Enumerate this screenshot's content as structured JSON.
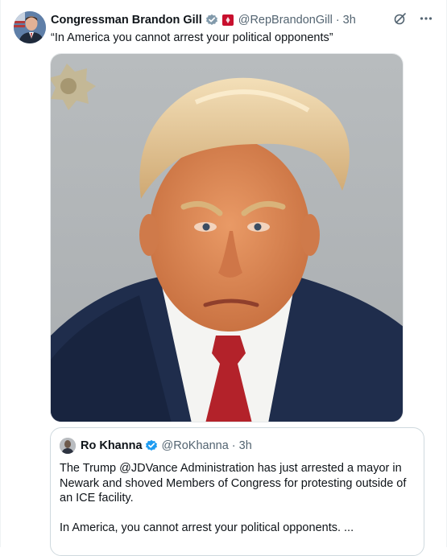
{
  "tweet": {
    "author_name": "Congressman Brandon Gill",
    "author_handle": "@RepBrandonGill",
    "separator": "·",
    "time": "3h",
    "text": "“In America you cannot arrest your political opponents”",
    "verified_icon": "verified-badge-icon",
    "flag_icon": "red-flag-affiliation-icon",
    "action_icons": [
      "grok-icon",
      "more-options-icon"
    ],
    "accent_color": "#1d9bf0"
  },
  "quoted_tweet": {
    "author_name": "Ro Khanna",
    "author_handle": "@RoKhanna",
    "separator": "·",
    "time": "3h",
    "paragraph_1": "The Trump @JDVance Administration has just arrested a mayor in Newark and shoved Members of Congress for protesting outside of an ICE facility.",
    "paragraph_2": "In America, you cannot arrest your political opponents. ..."
  }
}
